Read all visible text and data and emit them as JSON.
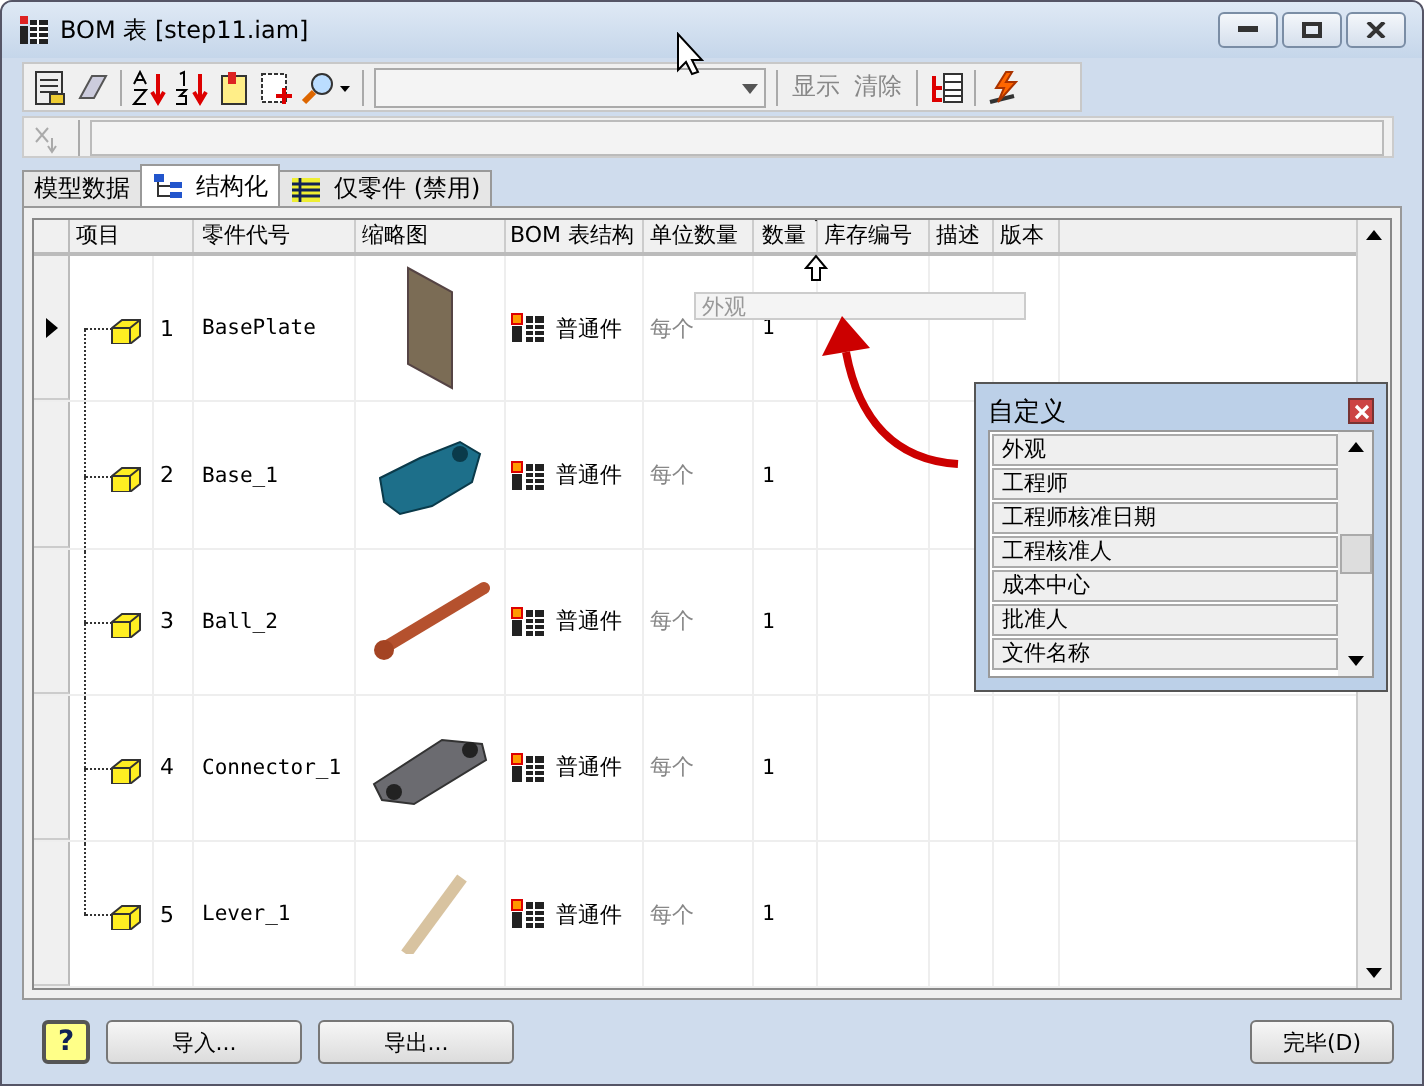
{
  "window": {
    "title": "BOM 表 [step11.iam]"
  },
  "toolbar": {
    "text_buttons": [
      {
        "label": "显示",
        "disabled": true
      },
      {
        "label": "清除",
        "disabled": true
      }
    ]
  },
  "tabs": [
    {
      "label": "模型数据",
      "selected": false
    },
    {
      "label": "结构化",
      "selected": true
    },
    {
      "label": "仅零件 (禁用)",
      "selected": false
    }
  ],
  "table": {
    "columns": [
      "项目",
      "零件代号",
      "缩略图",
      "BOM 表结构",
      "单位数量",
      "数量",
      "库存编号",
      "描述",
      "版本"
    ],
    "rows": [
      {
        "item": "1",
        "part_number": "BasePlate",
        "structure": "普通件",
        "unit_qty": "每个",
        "qty": "1",
        "selected": true
      },
      {
        "item": "2",
        "part_number": "Base_1",
        "structure": "普通件",
        "unit_qty": "每个",
        "qty": "1",
        "selected": false
      },
      {
        "item": "3",
        "part_number": "Ball_2",
        "structure": "普通件",
        "unit_qty": "每个",
        "qty": "1",
        "selected": false
      },
      {
        "item": "4",
        "part_number": "Connector_1",
        "structure": "普通件",
        "unit_qty": "每个",
        "qty": "1",
        "selected": false
      },
      {
        "item": "5",
        "part_number": "Lever_1",
        "structure": "普通件",
        "unit_qty": "每个",
        "qty": "1",
        "selected": false
      }
    ]
  },
  "drag_column": {
    "label": "外观"
  },
  "customize_panel": {
    "title": "自定义",
    "items": [
      "外观",
      "工程师",
      "工程师核准日期",
      "工程核准人",
      "成本中心",
      "批准人",
      "文件名称"
    ]
  },
  "buttons": {
    "help": "?",
    "import": "导入...",
    "export": "导出...",
    "done": "完毕(D)"
  }
}
